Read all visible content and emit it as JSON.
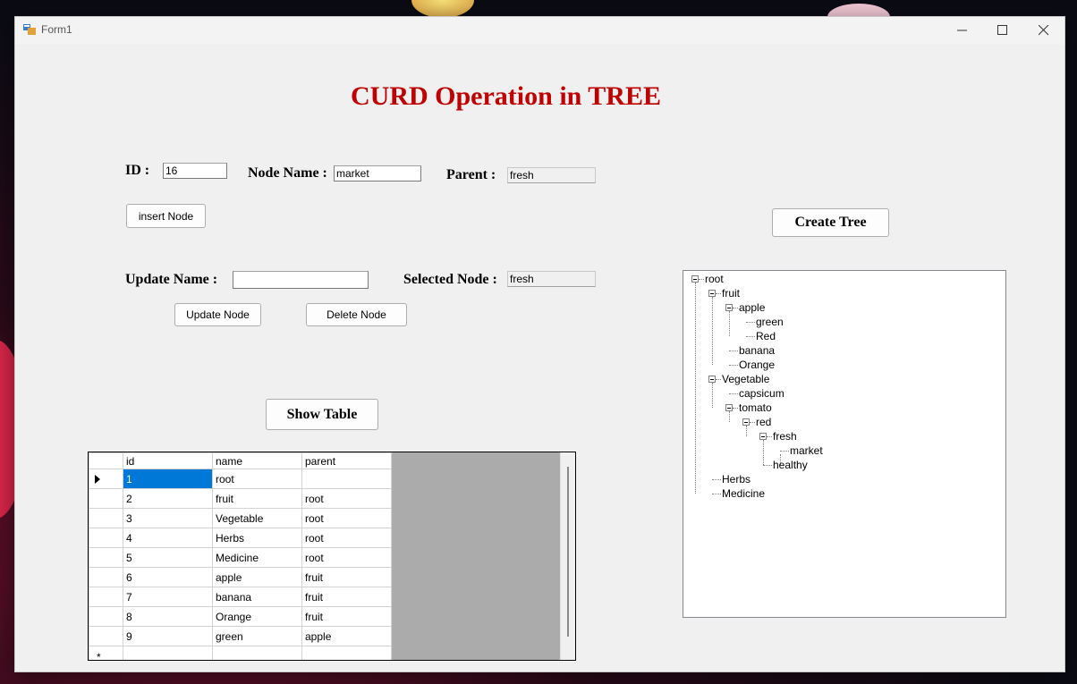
{
  "window": {
    "title": "Form1"
  },
  "heading": "CURD Operation in TREE",
  "form": {
    "id_label": "ID :",
    "id_value": "16",
    "node_name_label": "Node Name :",
    "node_name_value": "market",
    "parent_label": "Parent :",
    "parent_value": "fresh",
    "insert_button": "insert Node",
    "create_tree_button": "Create Tree",
    "update_name_label": "Update  Name :",
    "update_name_value": "",
    "selected_node_label": "Selected Node  :",
    "selected_node_value": "fresh",
    "update_button": "Update Node",
    "delete_button": "Delete Node",
    "show_table_button": "Show Table"
  },
  "table": {
    "columns": [
      "id",
      "name",
      "parent"
    ],
    "rows": [
      [
        "1",
        "root",
        ""
      ],
      [
        "2",
        "fruit",
        "root"
      ],
      [
        "3",
        "Vegetable",
        "root"
      ],
      [
        "4",
        "Herbs",
        "root"
      ],
      [
        "5",
        "Medicine",
        "root"
      ],
      [
        "6",
        "apple",
        "fruit"
      ],
      [
        "7",
        "banana",
        "fruit"
      ],
      [
        "8",
        "Orange",
        "fruit"
      ],
      [
        "9",
        "green",
        "apple"
      ]
    ],
    "new_row_marker": "*"
  },
  "tree": {
    "nodes": [
      "root",
      "fruit",
      "apple",
      "green",
      "Red",
      "banana",
      "Orange",
      "Vegetable",
      "capsicum",
      "tomato",
      "red",
      "fresh",
      "market",
      "healthy",
      "Herbs",
      "Medicine"
    ]
  },
  "colors": {
    "heading": "#c00000",
    "selection": "#0078d7"
  },
  "icons": [
    "form-app-icon",
    "minimize-icon",
    "maximize-icon",
    "close-icon",
    "row-pointer-icon",
    "collapse-icon"
  ]
}
